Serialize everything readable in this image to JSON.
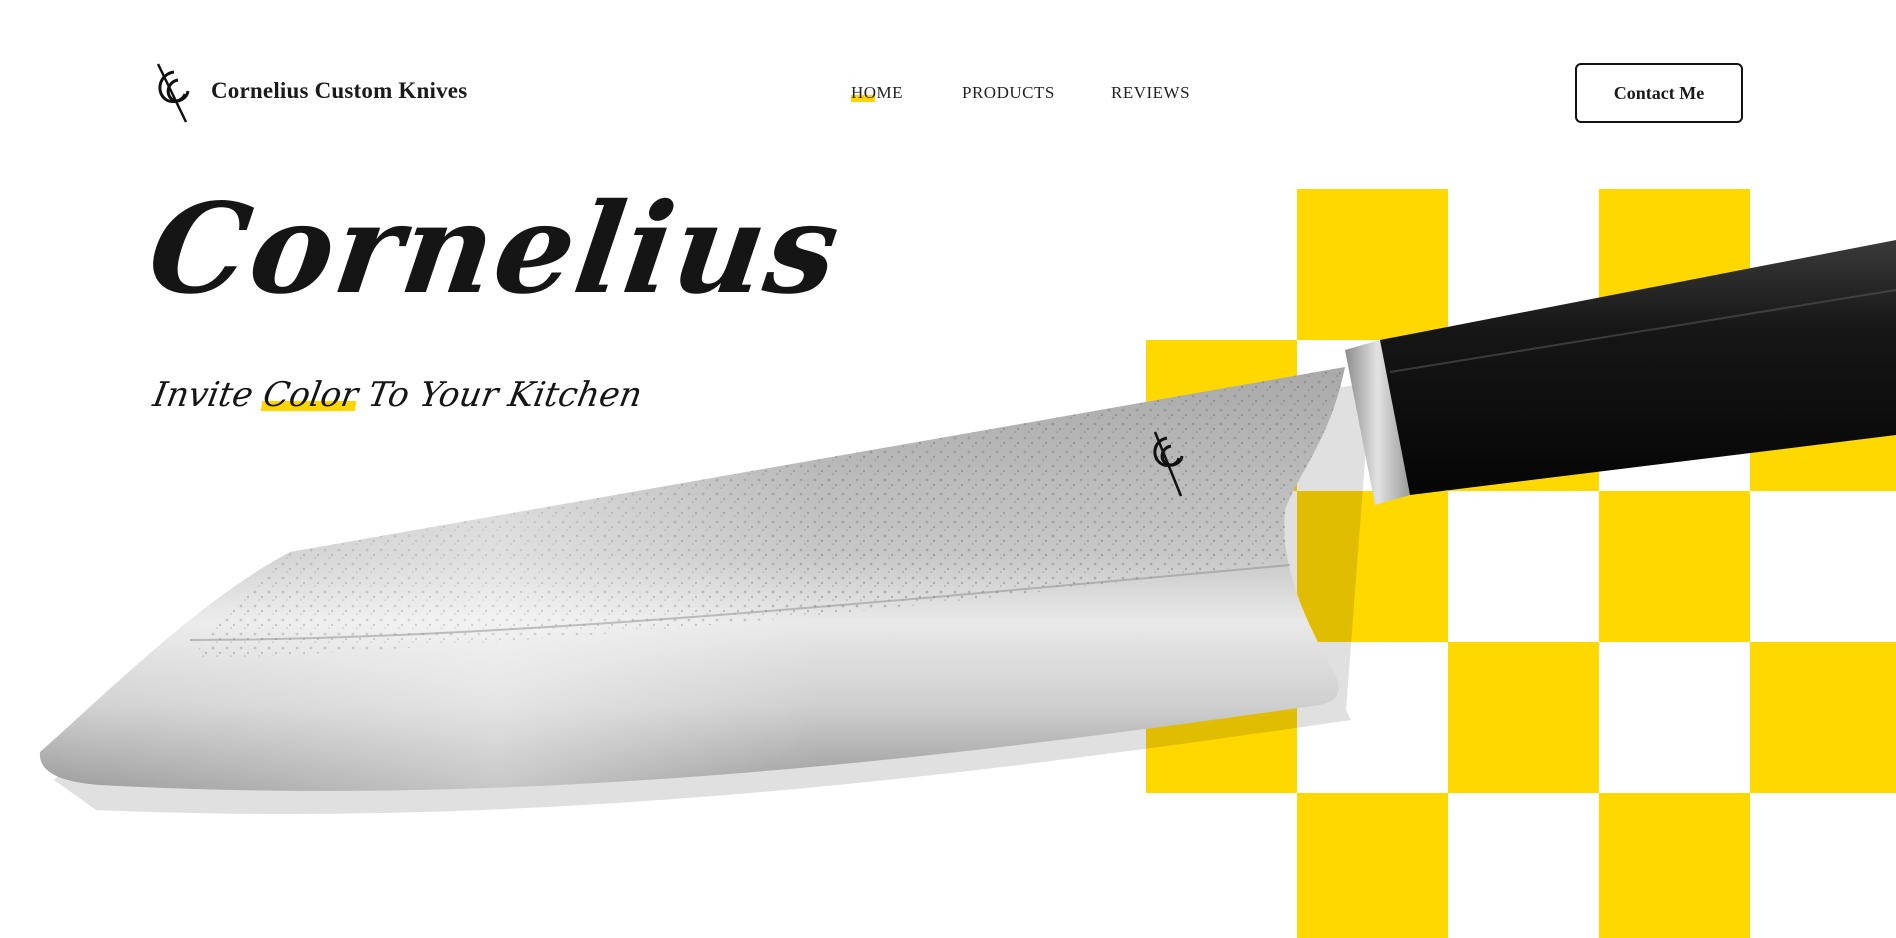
{
  "header": {
    "brand_name": "Cornelius Custom Knives",
    "logo_icon": "cc-monogram-icon",
    "nav": [
      {
        "label": "HOME",
        "active": true
      },
      {
        "label": "PRODUCTS",
        "active": false
      },
      {
        "label": "REVIEWS",
        "active": false
      }
    ],
    "contact_label": "Contact Me"
  },
  "hero": {
    "title": "Cornelius",
    "tagline_parts": [
      "Invite ",
      "Color",
      " To Your Kitchen"
    ],
    "knife_image": "chef-knife-photo"
  },
  "colors": {
    "accent": "#ffd800",
    "text": "#151515",
    "background": "#ffffff",
    "handle": "#121212",
    "blade": "#bdbdbd"
  }
}
